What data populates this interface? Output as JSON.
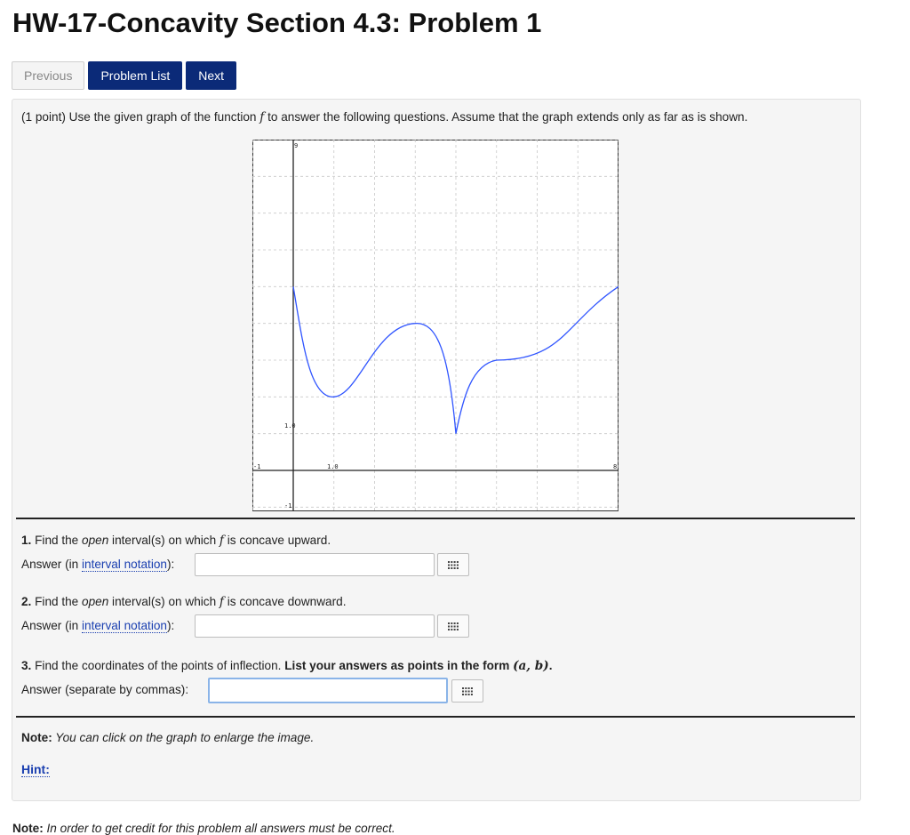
{
  "title": "HW-17-Concavity Section 4.3: Problem 1",
  "nav": {
    "previous_label": "Previous",
    "problem_list_label": "Problem List",
    "next_label": "Next"
  },
  "problem": {
    "points_prefix": "(1 point) Use the given graph of the function ",
    "function_symbol": "f",
    "points_suffix": " to answer the following questions. Assume that the graph extends only as far as is shown."
  },
  "graph": {
    "x_tick_labels": [
      "-1",
      "1.0",
      "8"
    ],
    "y_tick_labels": [
      "9",
      "1.0",
      "-1"
    ],
    "xlim": [
      -1,
      8
    ],
    "ylim": [
      -1,
      9
    ],
    "grid": true,
    "curve_color": "#2f54ff",
    "curve_points": [
      [
        0,
        5
      ],
      [
        1,
        2
      ],
      [
        3,
        4
      ],
      [
        4,
        1
      ],
      [
        5,
        3
      ],
      [
        8,
        5
      ]
    ]
  },
  "questions": [
    {
      "number": "1.",
      "text_before": " Find the ",
      "emphasis": "open",
      "text_middle": " interval(s) on which ",
      "symbol": "f",
      "text_after": " is concave upward.",
      "answer_prefix": "Answer (in ",
      "answer_link": "interval notation",
      "answer_suffix": "):",
      "value": ""
    },
    {
      "number": "2.",
      "text_before": " Find the ",
      "emphasis": "open",
      "text_middle": " interval(s) on which ",
      "symbol": "f",
      "text_after": " is concave downward.",
      "answer_prefix": "Answer (in ",
      "answer_link": "interval notation",
      "answer_suffix": "):",
      "value": ""
    },
    {
      "number": "3.",
      "text_plain": " Find the coordinates of the points of inflection. ",
      "text_bold": "List your answers as points in the form ",
      "form": "(a, b)",
      "period": ".",
      "answer_label": "Answer (separate by commas):",
      "value": ""
    }
  ],
  "note": {
    "label": "Note:",
    "text": " You can click on the graph to enlarge the image."
  },
  "hint_label": "Hint:",
  "footer_note": {
    "label": "Note:",
    "text": " In order to get credit for this problem all answers must be correct."
  },
  "icons": {
    "palette": "grid-palette-icon"
  }
}
